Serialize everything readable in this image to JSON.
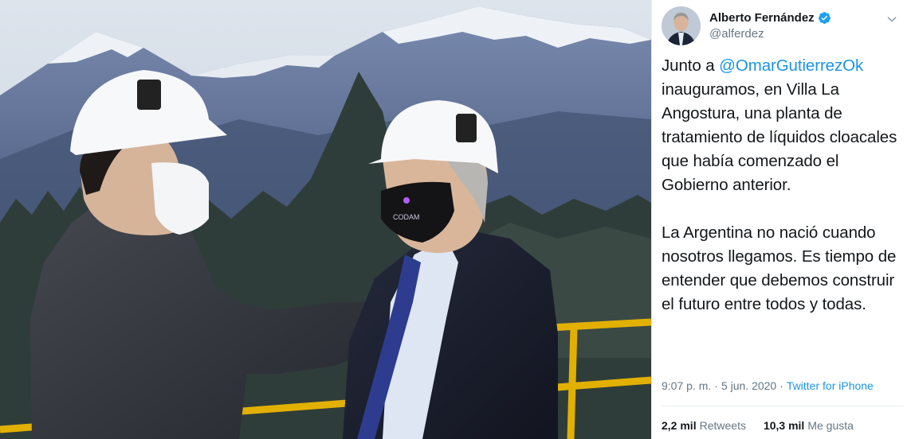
{
  "tweet": {
    "author": {
      "display_name": "Alberto Fernández",
      "handle": "@alferdez",
      "verified": true
    },
    "body": {
      "p1_prefix": "Junto a ",
      "p1_mention": "@OmarGutierrezOk",
      "p1_rest": " inauguramos, en Villa La Angostura, una planta de tratamiento de líquidos cloacales que había comenzado el Gobierno anterior.",
      "p2": "La Argentina no nació cuando nosotros llegamos. Es tiempo de entender que debemos construir el futuro entre todos y todas."
    },
    "meta": {
      "time": "9:07 p. m.",
      "separator1": "·",
      "date": "5 jun. 2020",
      "separator2": "·",
      "source": "Twitter for iPhone"
    },
    "stats": {
      "retweets_count": "2,2 mil",
      "retweets_label": "Retweets",
      "likes_count": "10,3 mil",
      "likes_label": "Me gusta"
    }
  },
  "photo": {
    "mask_text": "CODAM"
  },
  "colors": {
    "link": "#1b95e0",
    "text": "#14171a",
    "secondary": "#657786",
    "sky": "#dfe6ef",
    "mountain": "#6b7ea6",
    "railing": "#e8b400"
  }
}
